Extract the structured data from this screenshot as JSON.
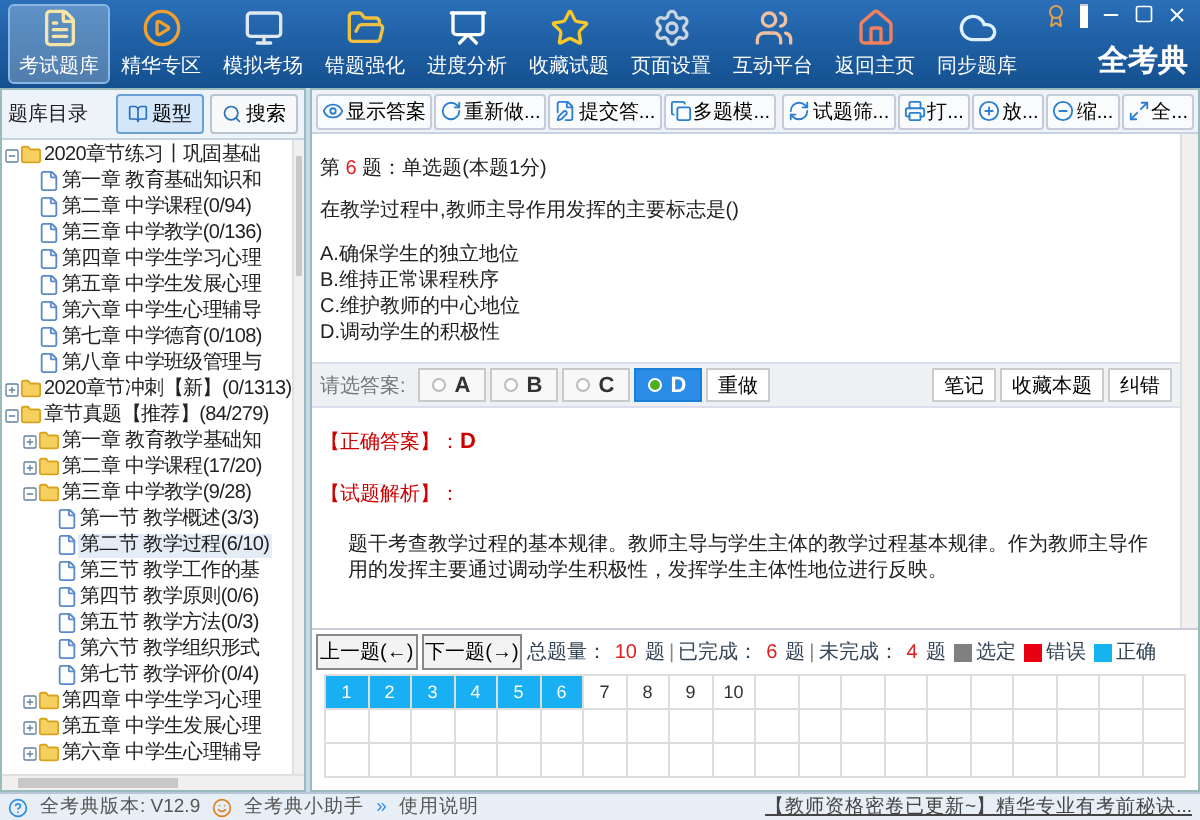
{
  "nav": [
    {
      "label": "考试题库",
      "kind": "papers",
      "selected": true
    },
    {
      "label": "精华专区",
      "kind": "play",
      "selected": false
    },
    {
      "label": "模拟考场",
      "kind": "monitor",
      "selected": false
    },
    {
      "label": "错题强化",
      "kind": "folder",
      "selected": false
    },
    {
      "label": "进度分析",
      "kind": "chart",
      "selected": false
    },
    {
      "label": "收藏试题",
      "kind": "star",
      "selected": false
    },
    {
      "label": "页面设置",
      "kind": "gear",
      "selected": false
    },
    {
      "label": "互动平台",
      "kind": "people",
      "selected": false
    },
    {
      "label": "返回主页",
      "kind": "home",
      "selected": false
    },
    {
      "label": "同步题库",
      "kind": "cloud",
      "selected": false
    }
  ],
  "brand": "全考典",
  "sidebar": {
    "title": "题库目录",
    "buttons": [
      {
        "label": "题型",
        "kind": "book",
        "selected": true
      },
      {
        "label": "搜索",
        "kind": "search",
        "selected": false
      }
    ],
    "tree": [
      {
        "label": "2020章节练习丨巩固基础",
        "kind": "folder",
        "expanded": true,
        "selected": false,
        "children": [
          {
            "label": "第一章 教育基础知识和",
            "kind": "page",
            "selected": false
          },
          {
            "label": "第二章 中学课程(0/94)",
            "kind": "page",
            "selected": false
          },
          {
            "label": "第三章 中学教学(0/136)",
            "kind": "page",
            "selected": false
          },
          {
            "label": "第四章 中学生学习心理",
            "kind": "page",
            "selected": false
          },
          {
            "label": "第五章 中学生发展心理",
            "kind": "page",
            "selected": false
          },
          {
            "label": "第六章 中学生心理辅导",
            "kind": "page",
            "selected": false
          },
          {
            "label": "第七章 中学德育(0/108)",
            "kind": "page",
            "selected": false
          },
          {
            "label": "第八章 中学班级管理与",
            "kind": "page",
            "selected": false
          }
        ]
      },
      {
        "label": "2020章节冲刺【新】(0/1313)",
        "kind": "folder",
        "expanded": false,
        "selected": false
      },
      {
        "label": "章节真题【推荐】(84/279)",
        "kind": "folder",
        "expanded": true,
        "selected": false,
        "children": [
          {
            "label": "第一章 教育教学基础知",
            "kind": "folder",
            "expanded": false,
            "selected": false
          },
          {
            "label": "第二章 中学课程(17/20)",
            "kind": "folder",
            "expanded": false,
            "selected": false
          },
          {
            "label": "第三章 中学教学(9/28)",
            "kind": "folder",
            "expanded": true,
            "selected": false,
            "children": [
              {
                "label": "第一节 教学概述(3/3)",
                "kind": "page",
                "selected": false
              },
              {
                "label": "第二节 教学过程(6/10)",
                "kind": "page",
                "selected": true
              },
              {
                "label": "第三节 教学工作的基",
                "kind": "page",
                "selected": false
              },
              {
                "label": "第四节 教学原则(0/6)",
                "kind": "page",
                "selected": false
              },
              {
                "label": "第五节 教学方法(0/3)",
                "kind": "page",
                "selected": false
              },
              {
                "label": "第六节 教学组织形式",
                "kind": "page",
                "selected": false
              },
              {
                "label": "第七节 教学评价(0/4)",
                "kind": "page",
                "selected": false
              }
            ]
          },
          {
            "label": "第四章 中学生学习心理",
            "kind": "folder",
            "expanded": false,
            "selected": false
          },
          {
            "label": "第五章 中学生发展心理",
            "kind": "folder",
            "expanded": false,
            "selected": false
          },
          {
            "label": "第六章 中学生心理辅导",
            "kind": "folder",
            "expanded": false,
            "selected": false
          }
        ]
      }
    ]
  },
  "toolbar": {
    "left": [
      {
        "label": "显示答案",
        "kind": "eye"
      },
      {
        "label": "重新做...",
        "kind": "redo"
      },
      {
        "label": "提交答...",
        "kind": "submit"
      },
      {
        "label": "多题模...",
        "kind": "multi"
      }
    ],
    "right": [
      {
        "label": "试题筛...",
        "kind": "filter"
      },
      {
        "label": "打...",
        "kind": "print"
      },
      {
        "label": "放...",
        "kind": "zoomin"
      },
      {
        "label": "缩...",
        "kind": "zoomout"
      },
      {
        "label": "全...",
        "kind": "full"
      }
    ]
  },
  "question": {
    "prefix": "第",
    "number": "6",
    "suffix": "题：单选题(本题1分)",
    "stem": "在教学过程中,教师主导作用发挥的主要标志是()",
    "options": [
      "A.确保学生的独立地位",
      "B.维持正常课程秩序",
      "C.维护教师的中心地位",
      "D.调动学生的积极性"
    ]
  },
  "answer_bar": {
    "prompt": "请选答案:",
    "choices": [
      {
        "label": "A",
        "selected": false
      },
      {
        "label": "B",
        "selected": false
      },
      {
        "label": "C",
        "selected": false
      },
      {
        "label": "D",
        "selected": true
      }
    ],
    "redo": "重做",
    "actions": [
      "笔记",
      "收藏本题",
      "纠错"
    ]
  },
  "solution": {
    "answer_label": "【正确答案】：",
    "answer": "D",
    "analysis_label": "【试题解析】：",
    "analysis": "题干考查教学过程的基本规律。教师主导与学生主体的教学过程基本规律。作为教师主导作用的发挥主要通过调动学生积极性，发挥学生主体性地位进行反映。"
  },
  "progress": {
    "prev": "上一题(←)",
    "next": "下一题(→)",
    "total_label": "总题量：",
    "total": "10",
    "unit_1": "题",
    "separator_1": "|",
    "completed_label": "已完成：",
    "completed": "6",
    "unit_2": "题",
    "separator_2": "|",
    "remaining_label": "未完成：",
    "remaining": "4",
    "unit_3": "题",
    "legend": [
      {
        "label": "选定",
        "color": "#808080"
      },
      {
        "label": "错误",
        "color": "#e60012"
      },
      {
        "label": "正确",
        "color": "#14b4f0"
      }
    ]
  },
  "questions": [
    {
      "number": "1",
      "answered": true
    },
    {
      "number": "2",
      "answered": true
    },
    {
      "number": "3",
      "answered": true
    },
    {
      "number": "4",
      "answered": true
    },
    {
      "number": "5",
      "answered": true
    },
    {
      "number": "6",
      "answered": true
    },
    {
      "number": "7",
      "answered": false
    },
    {
      "number": "8",
      "answered": false
    },
    {
      "number": "9",
      "answered": false
    },
    {
      "number": "10",
      "answered": false
    }
  ],
  "status_bar": {
    "version": "全考典版本: V12.9",
    "helper": "全考典小助手",
    "separator": "»",
    "manual": "使用说明",
    "news": "【教师资格密卷已更新~】精华专业有考前秘诀..."
  }
}
